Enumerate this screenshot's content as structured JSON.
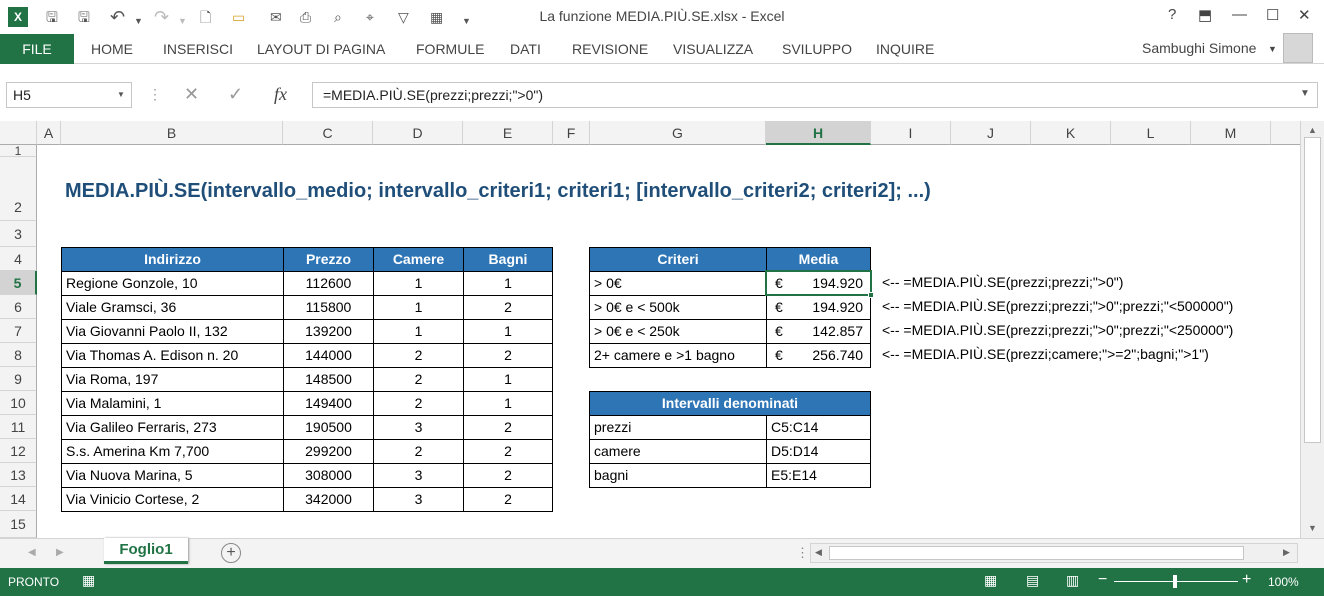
{
  "app": {
    "title": "La funzione MEDIA.PIÙ.SE.xlsx - Excel",
    "excel_icon": "excel-logo-icon",
    "accent": "#217346"
  },
  "window": {
    "help": "?",
    "minimize": "—",
    "close": "✕"
  },
  "ribbon": {
    "file": "FILE",
    "tabs": [
      "HOME",
      "INSERISCI",
      "LAYOUT DI PAGINA",
      "FORMULE",
      "DATI",
      "REVISIONE",
      "VISUALIZZA",
      "SVILUPPO",
      "INQUIRE"
    ],
    "user": "Sambughi Simone"
  },
  "formula_bar": {
    "name_box": "H5",
    "fx": "fx",
    "formula": "=MEDIA.PIÙ.SE(prezzi;prezzi;\">0\")"
  },
  "columns": [
    "A",
    "B",
    "C",
    "D",
    "E",
    "F",
    "G",
    "H",
    "I",
    "J",
    "K",
    "L",
    "M"
  ],
  "rows": [
    "1",
    "2",
    "3",
    "4",
    "5",
    "6",
    "7",
    "8",
    "9",
    "10",
    "11",
    "12",
    "13",
    "14",
    "15"
  ],
  "syntax": "MEDIA.PIÙ.SE(intervallo_medio; intervallo_criteri1; criteri1; [intervallo_criteri2; criteri2]; ...)",
  "table1": {
    "headers": [
      "Indirizzo",
      "Prezzo",
      "Camere",
      "Bagni"
    ],
    "rows": [
      [
        "Regione Gonzole, 10",
        "112600",
        "1",
        "1"
      ],
      [
        "Viale Gramsci, 36",
        "115800",
        "1",
        "2"
      ],
      [
        "Via Giovanni Paolo II, 132",
        "139200",
        "1",
        "1"
      ],
      [
        "Via Thomas A. Edison n. 20",
        "144000",
        "2",
        "2"
      ],
      [
        "Via Roma, 197",
        "148500",
        "2",
        "1"
      ],
      [
        "Via Malamini, 1",
        "149400",
        "2",
        "1"
      ],
      [
        "Via Galileo Ferraris, 273",
        "190500",
        "3",
        "2"
      ],
      [
        "S.s. Amerina Km 7,700",
        "299200",
        "2",
        "2"
      ],
      [
        "Via Nuova Marina, 5",
        "308000",
        "3",
        "2"
      ],
      [
        "Via Vinicio Cortese, 2",
        "342000",
        "3",
        "2"
      ]
    ]
  },
  "table2": {
    "headers": [
      "Criteri",
      "Media"
    ],
    "rows": [
      [
        "> 0€",
        "€",
        "194.920"
      ],
      [
        "> 0€ e < 500k",
        "€",
        "194.920"
      ],
      [
        "> 0€ e < 250k",
        "€",
        "142.857"
      ],
      [
        "2+ camere e >1 bagno",
        "€",
        "256.740"
      ]
    ]
  },
  "notes": [
    "<-- =MEDIA.PIÙ.SE(prezzi;prezzi;\">0\")",
    "<-- =MEDIA.PIÙ.SE(prezzi;prezzi;\">0\";prezzi;\"<500000\")",
    "<-- =MEDIA.PIÙ.SE(prezzi;prezzi;\">0\";prezzi;\"<250000\")",
    "<-- =MEDIA.PIÙ.SE(prezzi;camere;\">=2\";bagni;\">1\")"
  ],
  "table3": {
    "header": "Intervalli denominati",
    "rows": [
      [
        "prezzi",
        "C5:C14"
      ],
      [
        "camere",
        "D5:D14"
      ],
      [
        "bagni",
        "E5:E14"
      ]
    ]
  },
  "sheet": {
    "tab": "Foglio1"
  },
  "status": {
    "ready": "PRONTO",
    "zoom": "100%"
  }
}
